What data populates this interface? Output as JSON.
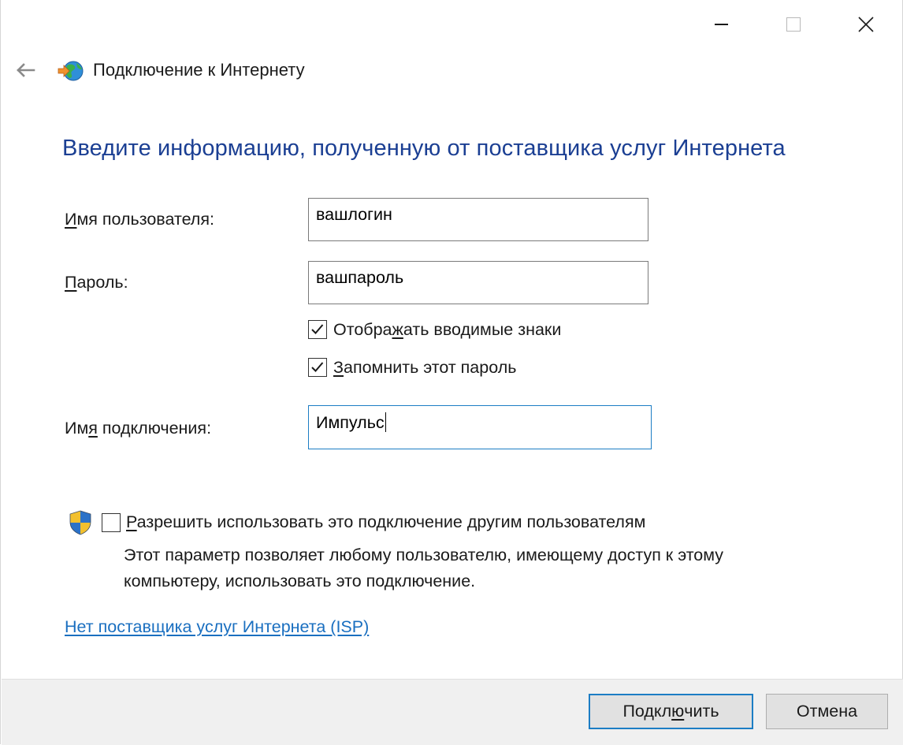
{
  "window": {
    "title": "Подключение к Интернету",
    "controls": {
      "minimize": "minimize-icon",
      "maximize": "maximize-icon",
      "close": "close-icon"
    }
  },
  "page": {
    "heading": "Введите информацию, полученную от поставщика услуг Интернета"
  },
  "form": {
    "username": {
      "label_accel": "И",
      "label_rest": "мя пользователя:",
      "value": "вашлогин"
    },
    "password": {
      "label_accel": "П",
      "label_rest": "ароль:",
      "value": "вашпароль"
    },
    "show_chars": {
      "label_pre": "Отобра",
      "label_accel": "ж",
      "label_post": "ать вводимые знаки",
      "checked": true
    },
    "remember": {
      "label_accel": "З",
      "label_rest": "апомнить этот пароль",
      "checked": true
    },
    "connection_name": {
      "label_pre": "Им",
      "label_accel": "я",
      "label_post": " подключения:",
      "value": "Импульс"
    },
    "allow_others": {
      "label_accel": "Р",
      "label_rest": "азрешить использовать это подключение другим пользователям",
      "checked": false,
      "description": "Этот параметр позволяет любому пользователю, имеющему доступ к этому компьютеру, использовать это подключение."
    }
  },
  "links": {
    "no_isp": "Нет поставщика услуг Интернета (ISP)"
  },
  "buttons": {
    "connect_pre": "Подкл",
    "connect_accel": "ю",
    "connect_post": "чить",
    "cancel": "Отмена"
  },
  "colors": {
    "heading": "#1b3f93",
    "link": "#1a6fc0",
    "focus_border": "#1c7dc4"
  }
}
